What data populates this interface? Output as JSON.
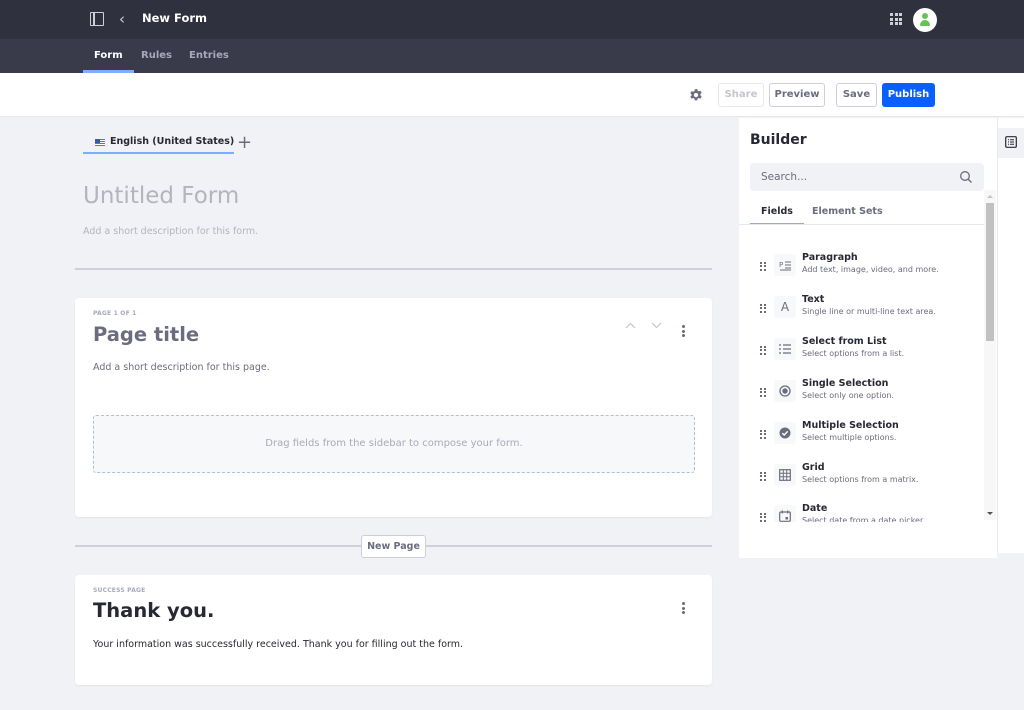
{
  "topbar": {
    "title": "New Form",
    "icons": {
      "panel": "sidebar-panel-icon",
      "back": "chevron-left-icon",
      "apps": "apps-grid-icon",
      "user": "user-avatar-icon"
    },
    "avatar_color": "#6bbf59"
  },
  "nav": {
    "tabs": [
      {
        "label": "Form",
        "active": true
      },
      {
        "label": "Rules",
        "active": false
      },
      {
        "label": "Entries",
        "active": false
      }
    ]
  },
  "toolbar": {
    "settings_icon": "gear-icon",
    "share_label": "Share",
    "preview_label": "Preview",
    "save_label": "Save",
    "publish_label": "Publish",
    "primary_color": "#0b5fff"
  },
  "form": {
    "language": "English (United States)",
    "title_placeholder": "Untitled Form",
    "description_placeholder": "Add a short description for this form.",
    "page": {
      "eyebrow": "PAGE 1 OF 1",
      "title": "Page title",
      "description": "Add a short description for this page.",
      "dropzone_text": "Drag fields from the sidebar to compose your form."
    },
    "new_page_label": "New Page",
    "success_page": {
      "eyebrow": "SUCCESS PAGE",
      "title": "Thank you.",
      "body": "Your information was successfully received. Thank you for filling out the form."
    }
  },
  "builder": {
    "title": "Builder",
    "search_placeholder": "Search...",
    "tabs": [
      {
        "label": "Fields",
        "active": true
      },
      {
        "label": "Element Sets",
        "active": false
      }
    ],
    "fields": [
      {
        "name": "Paragraph",
        "description": "Add text, image, video, and more.",
        "icon": "paragraph-icon"
      },
      {
        "name": "Text",
        "description": "Single line or multi-line text area.",
        "icon": "text-icon"
      },
      {
        "name": "Select from List",
        "description": "Select options from a list.",
        "icon": "list-icon"
      },
      {
        "name": "Single Selection",
        "description": "Select only one option.",
        "icon": "radio-icon"
      },
      {
        "name": "Multiple Selection",
        "description": "Select multiple options.",
        "icon": "checkbox-icon"
      },
      {
        "name": "Grid",
        "description": "Select options from a matrix.",
        "icon": "grid-icon"
      },
      {
        "name": "Date",
        "description": "Select date from a date picker.",
        "icon": "calendar-icon"
      }
    ]
  }
}
